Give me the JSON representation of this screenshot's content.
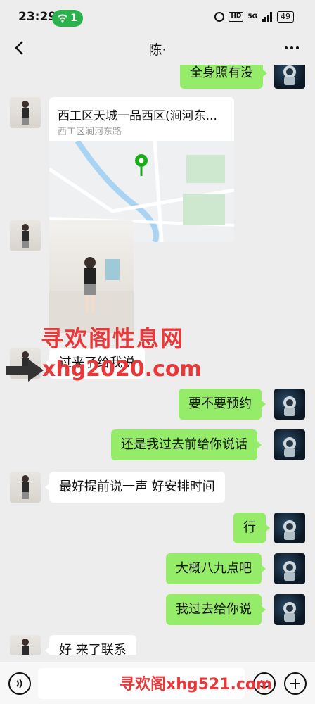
{
  "status_bar": {
    "time": "23:29",
    "notification_count": "1",
    "network_label": "5G",
    "hd_label": "HD",
    "battery": "49"
  },
  "nav": {
    "title": "陈·"
  },
  "messages": {
    "m0": "全身照有没",
    "location_title": "西工区天城一品西区(涧河东...",
    "location_subtitle": "西工区涧河东路",
    "m_partial": "过来了给我说",
    "m1": "要不要预约",
    "m2": "还是我过去前给你说话",
    "m3": "最好提前说一声 好安排时间",
    "m4": "行",
    "m5": "大概八九点吧",
    "m6": "我过去给你说",
    "m7": "好 来了联系"
  },
  "watermarks": {
    "top": "寻欢阁性息网",
    "mid": "xhg2020.com",
    "bottom": "寻欢阁xhg521.com"
  },
  "input_bar": {
    "placeholder": ""
  },
  "colors": {
    "accent_green": "#95ec69",
    "status_green": "#2bb24c",
    "watermark_red": "#e8383a",
    "background": "#ededed"
  }
}
